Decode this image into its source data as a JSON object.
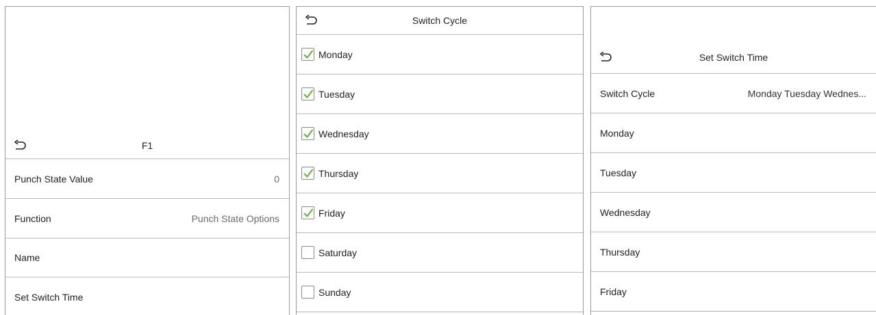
{
  "screen1": {
    "title": "F1",
    "back_icon": "back-arrow-icon",
    "rows": [
      {
        "label": "Punch State Value",
        "value": "0"
      },
      {
        "label": "Function",
        "value": "Punch State Options"
      },
      {
        "label": "Name",
        "value": ""
      },
      {
        "label": "Set Switch Time",
        "value": ""
      }
    ]
  },
  "screen2": {
    "title": "Switch Cycle",
    "back_icon": "back-arrow-icon",
    "check_color": "#5cb531",
    "days": [
      {
        "label": "Monday",
        "checked": true
      },
      {
        "label": "Tuesday",
        "checked": true
      },
      {
        "label": "Wednesday",
        "checked": true
      },
      {
        "label": "Thursday",
        "checked": true
      },
      {
        "label": "Friday",
        "checked": true
      },
      {
        "label": "Saturday",
        "checked": false
      },
      {
        "label": "Sunday",
        "checked": false
      }
    ]
  },
  "screen3": {
    "title": "Set Switch Time",
    "back_icon": "back-arrow-icon",
    "rows": [
      {
        "label": "Switch Cycle",
        "value": "Monday Tuesday Wednes..."
      },
      {
        "label": "Monday",
        "value": ""
      },
      {
        "label": "Tuesday",
        "value": ""
      },
      {
        "label": "Wednesday",
        "value": ""
      },
      {
        "label": "Thursday",
        "value": ""
      },
      {
        "label": "Friday",
        "value": ""
      }
    ]
  }
}
